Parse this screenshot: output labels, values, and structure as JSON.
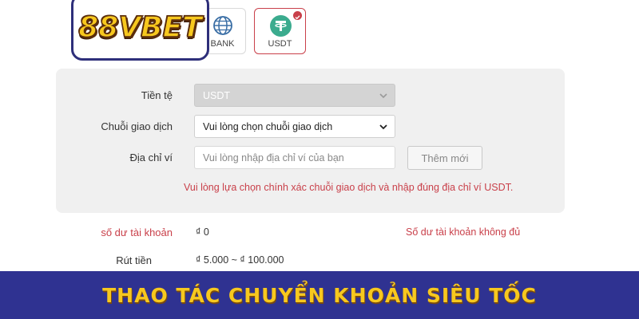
{
  "logo": {
    "text": "88VBET"
  },
  "methods": [
    {
      "label": "BANK",
      "icon": "globe-icon"
    },
    {
      "label": "USDT",
      "icon": "tether-icon",
      "selected": true
    }
  ],
  "form": {
    "currency": {
      "label": "Tiền tệ",
      "value": "USDT"
    },
    "chain": {
      "label": "Chuỗi giao dịch",
      "value": "Vui lòng chọn chuỗi giao dịch"
    },
    "wallet": {
      "label": "Địa chỉ ví",
      "placeholder": "Vui lòng nhập địa chỉ ví của bạn",
      "add_button": "Thêm mới"
    },
    "warning": "Vui lòng lựa chọn chính xác chuỗi giao dịch và nhập đúng địa chỉ ví USDT."
  },
  "balance": {
    "label": "số dư tài khoản",
    "value": "₫ 0",
    "warning": "Số dư tài khoản không đủ"
  },
  "withdraw": {
    "label": "Rút tiền",
    "range": "₫ 5.000 ~ ₫ 100.000"
  },
  "banner": {
    "text": "THAO TÁC CHUYỂN KHOẢN SIÊU TỐC"
  },
  "colors": {
    "accent_red": "#c9404a",
    "banner_bg": "#2f3291",
    "banner_text": "#f7c81e",
    "tether_green": "#3bab8e"
  }
}
